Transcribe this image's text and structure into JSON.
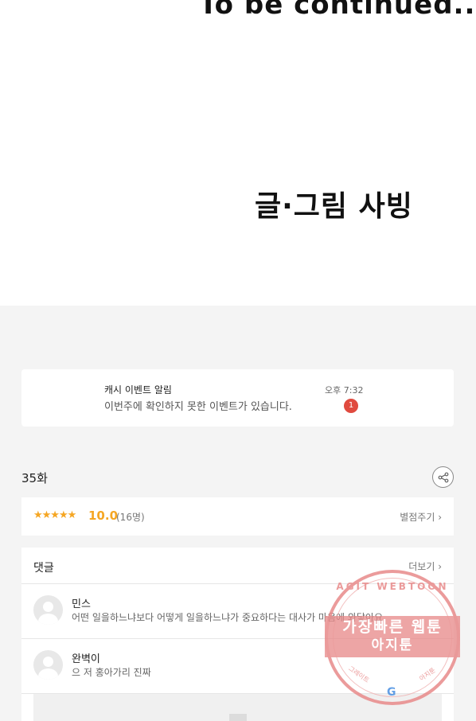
{
  "comic": {
    "tbc_text": "To be continued..",
    "credit_text": "글·그림  사빙"
  },
  "notification": {
    "title": "캐시 이벤트 알림",
    "message": "이번주에 확인하지 못한 이벤트가 있습니다.",
    "time": "오후 7:32",
    "badge_count": "1",
    "badge_color": "#e04a3f"
  },
  "episode": {
    "label": "35화",
    "share_icon": "share-icon"
  },
  "rating": {
    "stars": "★★★★★",
    "score": "10.0",
    "raters": "(16명)",
    "rate_link": "별점주기 ›",
    "accent_color": "#f5a623"
  },
  "comments": {
    "title": "댓글",
    "more_link": "더보기 ›",
    "items": [
      {
        "name": "민스",
        "text": "어떤 일을하느냐보다 어떻게 일을하느냐가 중요하다는 대사가 마음에 와닿아요"
      },
      {
        "name": "완벽이",
        "text": "으 저 홍아가리 진짜"
      }
    ]
  },
  "watermark": {
    "arc_text": "AGIT WEBTOON",
    "line1": "가장빠른 웹툰",
    "line2": "아지툰",
    "small_left": "그레이트",
    "small_right": "아지툰",
    "logo": "G"
  }
}
